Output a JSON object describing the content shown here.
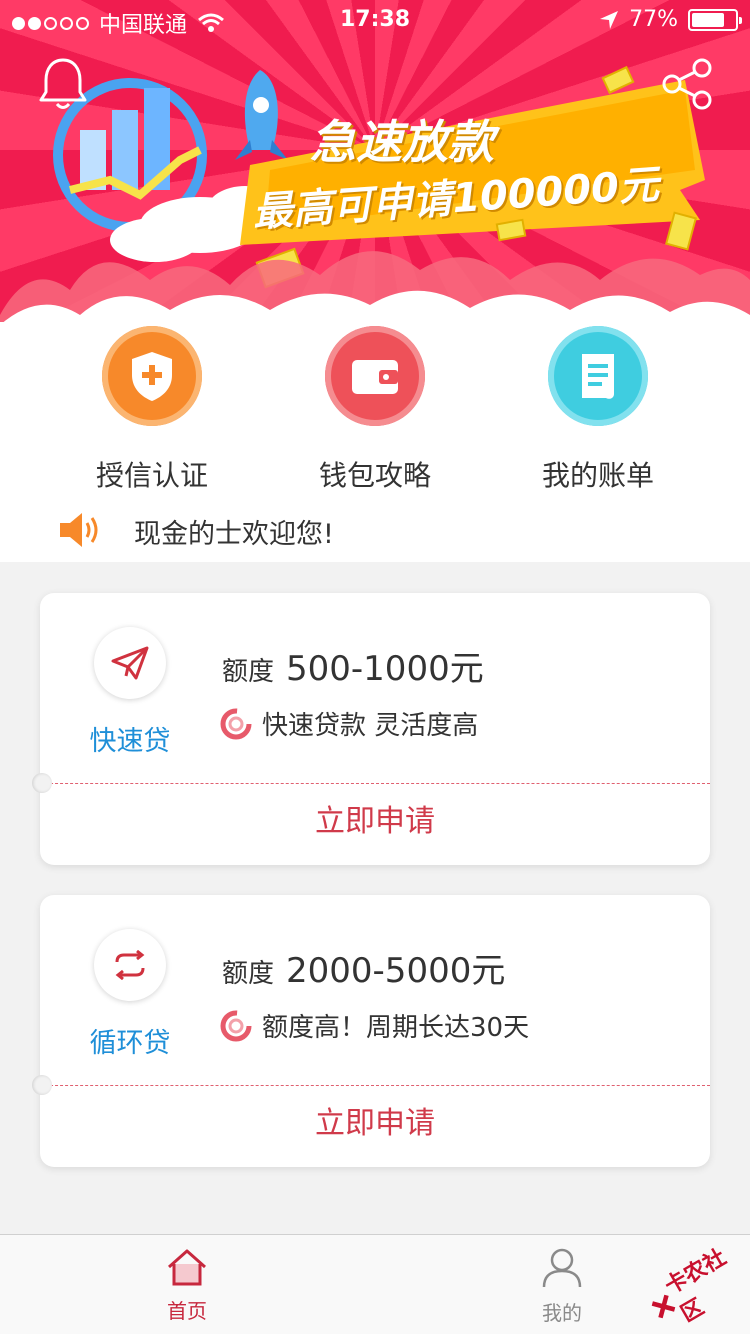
{
  "status_bar": {
    "carrier": "中国联通",
    "time": "17:38",
    "battery": "77%",
    "battery_level": 0.77,
    "signal_bars": 2
  },
  "hero": {
    "headline": "急速放款",
    "subline": "最高可申请100000元"
  },
  "quick_actions": [
    {
      "label": "授信认证",
      "icon": "shield-plus-icon",
      "color": "#f7892a"
    },
    {
      "label": "钱包攻略",
      "icon": "wallet-icon",
      "color": "#ee5159"
    },
    {
      "label": "我的账单",
      "icon": "bill-scroll-icon",
      "color": "#3fcde0"
    }
  ],
  "notice": {
    "text": "现金的士欢迎您!"
  },
  "products": [
    {
      "name": "快速贷",
      "icon": "paper-plane-icon",
      "limit_label": "额度",
      "limit_value": "500-1000元",
      "description": "快速贷款 灵活度高",
      "apply_label": "立即申请"
    },
    {
      "name": "循环贷",
      "icon": "cycle-arrows-icon",
      "limit_label": "额度",
      "limit_value": "2000-5000元",
      "description": "额度高！周期长达30天",
      "apply_label": "立即申请"
    }
  ],
  "tabbar": {
    "tabs": [
      {
        "label": "首页",
        "icon": "home-icon",
        "active": true
      },
      {
        "label": "我的",
        "icon": "person-icon",
        "active": false
      }
    ],
    "active_color": "#c7283e",
    "inactive_color": "#8a8a8a"
  },
  "watermark": "卡农社区"
}
